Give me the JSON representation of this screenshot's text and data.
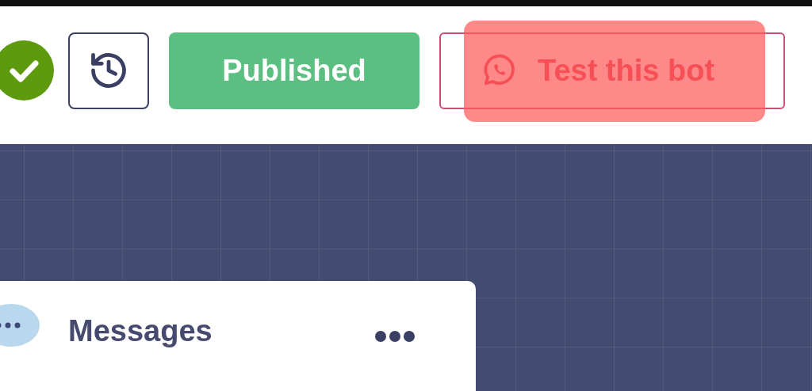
{
  "header": {
    "published_button": {
      "label": "Published"
    },
    "test_button": {
      "label": "Test this bot"
    }
  },
  "canvas": {
    "card": {
      "title": "Messages"
    }
  }
}
